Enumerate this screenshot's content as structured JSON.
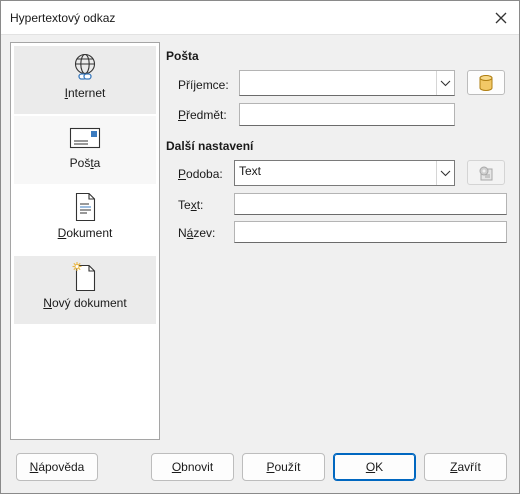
{
  "window": {
    "title": "Hypertextový odkaz"
  },
  "sidebar": {
    "items": [
      {
        "label_pre": "",
        "label_key": "I",
        "label_post": "nternet",
        "icon": "globe-link-icon"
      },
      {
        "label_pre": "Poš",
        "label_key": "t",
        "label_post": "a",
        "icon": "envelope-icon"
      },
      {
        "label_pre": "",
        "label_key": "D",
        "label_post": "okument",
        "icon": "document-icon"
      },
      {
        "label_pre": "",
        "label_key": "N",
        "label_post": "ový dokument",
        "icon": "new-document-icon"
      }
    ],
    "selected": 1
  },
  "mail": {
    "heading": "Pošta",
    "recipient_label_pre": "Pří",
    "recipient_label_key": "j",
    "recipient_label_post": "emce:",
    "recipient_value": "",
    "subject_label_pre": "",
    "subject_label_key": "P",
    "subject_label_post": "ředmět:",
    "subject_value": "",
    "datasource_icon": "database-icon"
  },
  "further": {
    "heading": "Další nastavení",
    "form_label_pre": "",
    "form_label_key": "P",
    "form_label_post": "odoba:",
    "form_value": "Text",
    "text_label_pre": "Te",
    "text_label_key": "x",
    "text_label_post": "t:",
    "text_value": "",
    "name_label_pre": "N",
    "name_label_key": "á",
    "name_label_post": "zev:",
    "name_value": "",
    "events_icon": "events-gear-icon"
  },
  "buttons": {
    "help_pre": "",
    "help_key": "N",
    "help_post": "ápověda",
    "reset_pre": "",
    "reset_key": "O",
    "reset_post": "bnovit",
    "apply_pre": "",
    "apply_key": "P",
    "apply_post": "oužít",
    "ok_pre": "",
    "ok_key": "O",
    "ok_post": "K",
    "close_pre": "",
    "close_key": "Z",
    "close_post": "avřít"
  },
  "colors": {
    "accent": "#0067c0",
    "link_icon": "#3b7bbf",
    "folder_icon": "#e8b84a"
  }
}
